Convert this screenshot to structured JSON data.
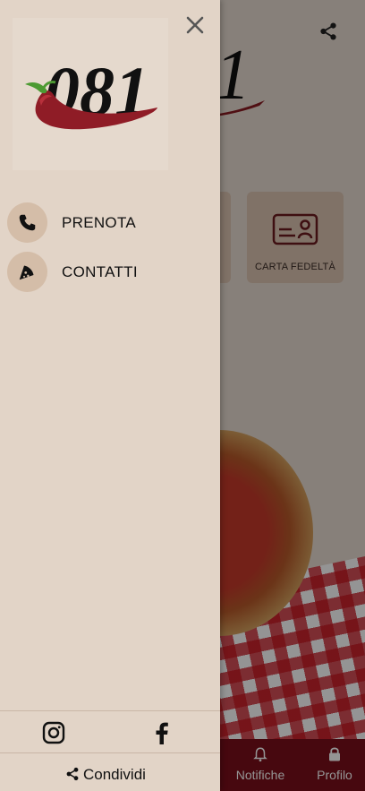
{
  "app": {
    "tiles": [
      {
        "label": ""
      },
      {
        "label": "CARTA FEDELTÀ",
        "icon": "loyalty-card-icon"
      }
    ],
    "tabbar": {
      "color": "#7a0f1a",
      "items": [
        {
          "label": "Notifiche",
          "icon": "bell-icon"
        },
        {
          "label": "Profilo",
          "icon": "lock-icon"
        }
      ]
    }
  },
  "drawer": {
    "logo_text": "081",
    "menu": [
      {
        "label": "PRENOTA",
        "icon": "phone-icon"
      },
      {
        "label": "CONTATTI",
        "icon": "pizza-slice-icon"
      }
    ],
    "social": [
      {
        "name": "instagram",
        "icon": "instagram-icon"
      },
      {
        "name": "facebook",
        "icon": "facebook-icon"
      }
    ],
    "share_label": "Condividi",
    "background": "#e2d4c7",
    "accent_circle": "#d4bda8"
  }
}
